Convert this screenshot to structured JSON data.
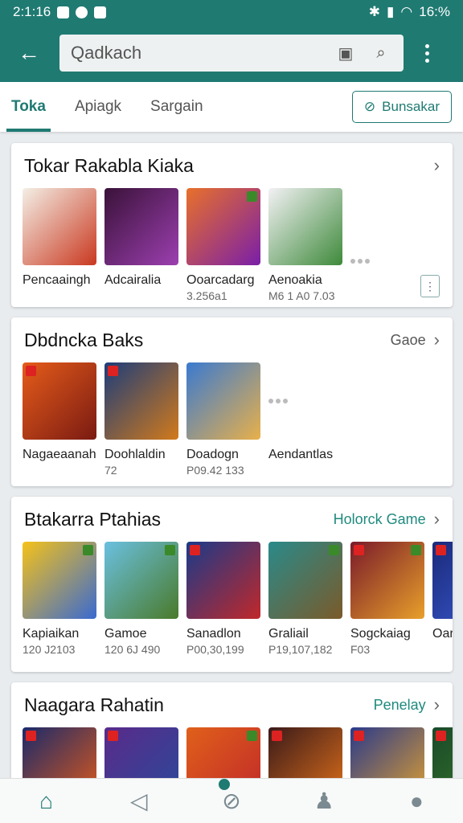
{
  "status_bar": {
    "time": "2:1:16",
    "battery": "16:%"
  },
  "app_bar": {
    "search_text": "Qadkach"
  },
  "tabs": [
    {
      "label": "Toka",
      "active": true
    },
    {
      "label": "Apiagk",
      "active": false
    },
    {
      "label": "Sargain",
      "active": false
    }
  ],
  "chip": {
    "label": "Bunsakar"
  },
  "sections": [
    {
      "title": "Tokar Rakabla Kiaka",
      "link": "",
      "items": [
        {
          "name": "Pencaaingh",
          "sub": "",
          "colors": [
            "#f4efe6",
            "#c9381f"
          ]
        },
        {
          "name": "Adcairalia",
          "sub": "",
          "colors": [
            "#3a1239",
            "#9c3fb0"
          ]
        },
        {
          "name": "Ooarcadarg",
          "sub": "3.256a1",
          "colors": [
            "#e8702a",
            "#7a1fa8"
          ]
        },
        {
          "name": "Aenoakia",
          "sub": "M6 1 A0 7.03",
          "colors": [
            "#f3f1f5",
            "#3e8a3a"
          ]
        }
      ]
    },
    {
      "title": "Dbdncka Baks",
      "link": "Gaoe",
      "items": [
        {
          "name": "Nagaeaanah",
          "sub": "",
          "colors": [
            "#e55c1a",
            "#7a1a12"
          ]
        },
        {
          "name": "Doohlaldin",
          "sub": "72",
          "colors": [
            "#1d3d7a",
            "#d27a1a"
          ]
        },
        {
          "name": "Doadogn",
          "sub": "P09.42 133",
          "colors": [
            "#3a7ad0",
            "#e8b04a"
          ]
        },
        {
          "name": "Aendantlas",
          "sub": ""
        }
      ]
    },
    {
      "title": "Btakarra Ptahias",
      "link": "Holorck Game",
      "items": [
        {
          "name": "Kapiaikan",
          "sub": "120 J2103",
          "colors": [
            "#f5c21a",
            "#3a6ad0"
          ]
        },
        {
          "name": "Gamoe",
          "sub": "120 6J 490",
          "colors": [
            "#6ac0e0",
            "#4a7a2a"
          ]
        },
        {
          "name": "Sanadlon",
          "sub": "P00,30,199",
          "colors": [
            "#1a3a8a",
            "#c0282a"
          ]
        },
        {
          "name": "Graliail",
          "sub": "P19,107,182",
          "colors": [
            "#2a8a8a",
            "#7a5a2a"
          ]
        },
        {
          "name": "Sogckaiag",
          "sub": "F03",
          "colors": [
            "#7a1a2a",
            "#e8a02a"
          ]
        },
        {
          "name": "Oar",
          "sub": "",
          "colors": [
            "#1a2a7a",
            "#3a5ad0"
          ]
        }
      ]
    },
    {
      "title": "Naagara Rahatin",
      "link": "Penelay",
      "items": [
        {
          "name": "",
          "sub": "",
          "colors": [
            "#1a2a6a",
            "#e05a1a"
          ]
        },
        {
          "name": "",
          "sub": "",
          "colors": [
            "#5a2a8a",
            "#2a4a9a"
          ]
        },
        {
          "name": "",
          "sub": "",
          "colors": [
            "#e0601a",
            "#c0282a"
          ]
        },
        {
          "name": "",
          "sub": "",
          "colors": [
            "#3a1a1a",
            "#e0701a"
          ]
        },
        {
          "name": "",
          "sub": "",
          "colors": [
            "#2a3a8a",
            "#e0a030"
          ]
        },
        {
          "name": "",
          "sub": "",
          "colors": [
            "#1a4a2a",
            "#3a7a2a"
          ]
        }
      ]
    }
  ],
  "bottom_nav": [
    {
      "icon": "home-icon",
      "active": true
    },
    {
      "icon": "send-icon",
      "active": false
    },
    {
      "icon": "block-icon",
      "active": false
    },
    {
      "icon": "person-icon",
      "active": false
    },
    {
      "icon": "account-icon",
      "active": false
    }
  ]
}
